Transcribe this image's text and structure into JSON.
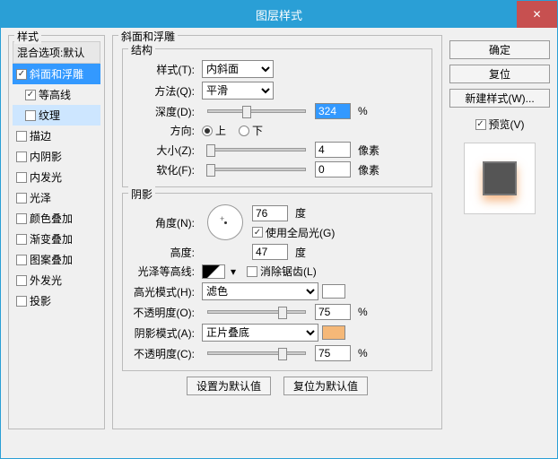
{
  "window": {
    "title": "图层样式",
    "close": "✕"
  },
  "left": {
    "legend": "样式",
    "blend": "混合选项:默认",
    "items": [
      {
        "label": "斜面和浮雕",
        "checked": true,
        "selected": true,
        "sub": false
      },
      {
        "label": "等高线",
        "checked": true,
        "selected": false,
        "sub": true
      },
      {
        "label": "纹理",
        "checked": false,
        "selected": false,
        "sub": true,
        "hl": true
      },
      {
        "label": "描边",
        "checked": false
      },
      {
        "label": "内阴影",
        "checked": false
      },
      {
        "label": "内发光",
        "checked": false
      },
      {
        "label": "光泽",
        "checked": false
      },
      {
        "label": "颜色叠加",
        "checked": false
      },
      {
        "label": "渐变叠加",
        "checked": false
      },
      {
        "label": "图案叠加",
        "checked": false
      },
      {
        "label": "外发光",
        "checked": false
      },
      {
        "label": "投影",
        "checked": false
      }
    ]
  },
  "center": {
    "legend": "斜面和浮雕",
    "struct": {
      "legend": "结构",
      "style_label": "样式(T):",
      "style_value": "内斜面",
      "tech_label": "方法(Q):",
      "tech_value": "平滑",
      "depth_label": "深度(D):",
      "depth_value": "324",
      "depth_unit": "%",
      "dir_label": "方向:",
      "dir_up": "上",
      "dir_down": "下",
      "size_label": "大小(Z):",
      "size_value": "4",
      "size_unit": "像素",
      "soften_label": "软化(F):",
      "soften_value": "0",
      "soften_unit": "像素"
    },
    "shadow": {
      "legend": "阴影",
      "angle_label": "角度(N):",
      "angle_value": "76",
      "angle_unit": "度",
      "global_label": "使用全局光(G)",
      "alt_label": "高度:",
      "alt_value": "47",
      "alt_unit": "度",
      "contour_label": "光泽等高线:",
      "aa_label": "消除锯齿(L)",
      "hi_label": "高光模式(H):",
      "hi_value": "滤色",
      "hi_op_label": "不透明度(O):",
      "hi_op_value": "75",
      "hi_op_unit": "%",
      "sh_label": "阴影模式(A):",
      "sh_value": "正片叠底",
      "sh_op_label": "不透明度(C):",
      "sh_op_value": "75",
      "sh_op_unit": "%"
    },
    "btn_default": "设置为默认值",
    "btn_reset": "复位为默认值"
  },
  "right": {
    "ok": "确定",
    "cancel": "复位",
    "new_style": "新建样式(W)...",
    "preview_label": "预览(V)"
  }
}
